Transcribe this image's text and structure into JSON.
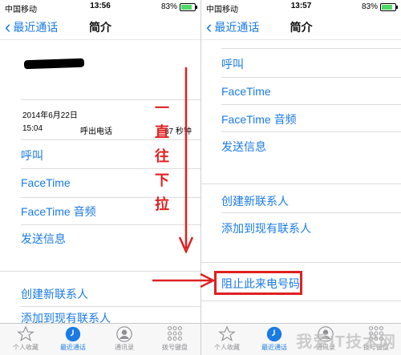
{
  "left": {
    "status": {
      "carrier": "中国移动",
      "time": "13:56",
      "battery": "83%"
    },
    "nav": {
      "back_label": "最近通话",
      "title": "简介"
    },
    "call": {
      "date": "2014年6月22日",
      "time": "15:04",
      "type": "呼出电话",
      "duration": "37 秒钟"
    },
    "actions": [
      "呼叫",
      "FaceTime",
      "FaceTime 音频",
      "发送信息"
    ],
    "contacts": [
      "创建新联系人",
      "添加到现有联系人"
    ]
  },
  "right": {
    "status": {
      "carrier": "中国移动",
      "time": "13:57",
      "battery": "83%"
    },
    "nav": {
      "back_label": "最近通话",
      "title": "简介"
    },
    "actions": [
      "呼叫",
      "FaceTime",
      "FaceTime 音频",
      "发送信息"
    ],
    "contacts": [
      "创建新联系人",
      "添加到现有联系人"
    ],
    "block": "阻止此来电号码"
  },
  "tabs": [
    {
      "label": "个人收藏",
      "icon": "star-icon"
    },
    {
      "label": "最近通话",
      "icon": "clock-icon"
    },
    {
      "label": "通讯录",
      "icon": "contacts-icon"
    },
    {
      "label": "拨号键盘",
      "icon": "keypad-icon"
    }
  ],
  "annotation": {
    "chars": [
      "一",
      "直",
      "往",
      "下",
      "拉"
    ]
  },
  "watermark": "我爱IT技术网",
  "colors": {
    "accent": "#1b7be4",
    "annotation": "#e02020",
    "battery": "#4cd964"
  }
}
